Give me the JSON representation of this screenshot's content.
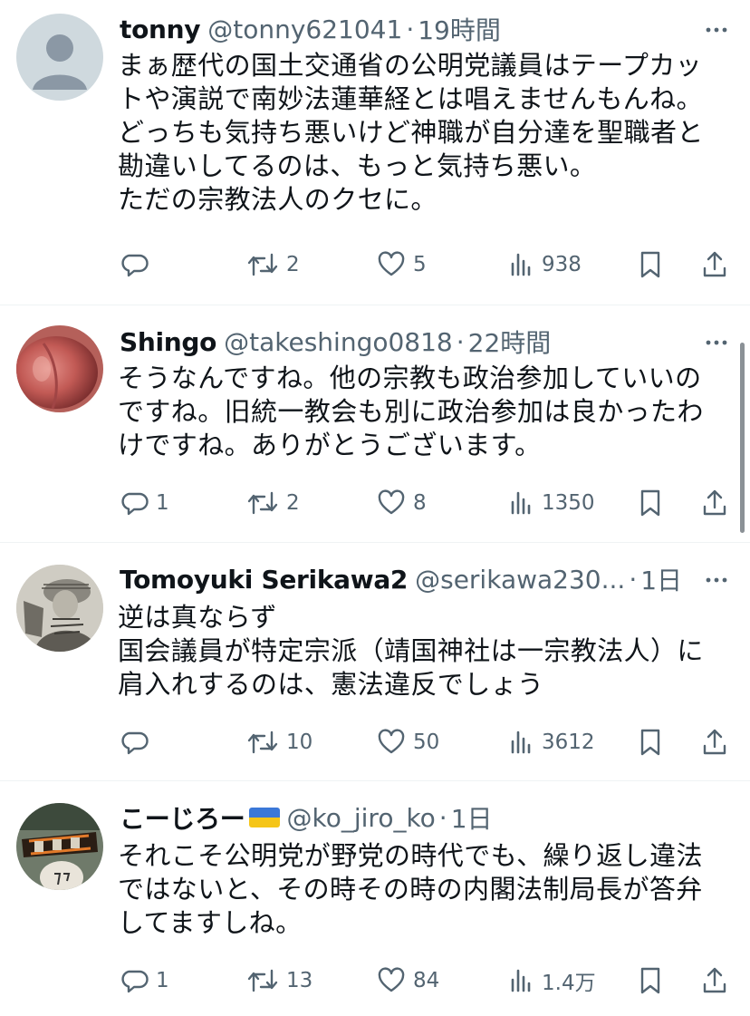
{
  "posts": [
    {
      "name": "tonny",
      "handle": "@tonny621041",
      "dot": "·",
      "time": "19時間",
      "text": "まぁ歴代の国土交通省の公明党議員はテープカットや演説で南妙法蓮華経とは唱えませんもんね。\nどっちも気持ち悪いけど神職が自分達を聖職者と勘違いしてるのは、もっと気持ち悪い。\nただの宗教法人のクセに。",
      "replies": "",
      "reposts": "2",
      "likes": "5",
      "views": "938"
    },
    {
      "name": "Shingo",
      "handle": "@takeshingo0818",
      "dot": "·",
      "time": "22時間",
      "text": "そうなんですね。他の宗教も政治参加していいのですね。旧統一教会も別に政治参加は良かったわけですね。ありがとうございます。",
      "replies": "1",
      "reposts": "2",
      "likes": "8",
      "views": "1350"
    },
    {
      "name": "Tomoyuki Serikawa2",
      "handle": "@serikawa230...",
      "dot": "·",
      "time": "1日",
      "text": "逆は真ならず\n国会議員が特定宗派（靖国神社は一宗教法人）に肩入れするのは、憲法違反でしょう",
      "replies": "",
      "reposts": "10",
      "likes": "50",
      "views": "3612"
    },
    {
      "name": "こーじろー",
      "handle": "@ko_jiro_ko",
      "dot": "·",
      "time": "1日",
      "text": "それこそ公明党が野党の時代でも、繰り返し違法ではないと、その時その時の内閣法制局長が答弁してますしね。",
      "replies": "1",
      "reposts": "13",
      "likes": "84",
      "views": "1.4万"
    }
  ],
  "icons": {
    "reply": "reply-icon",
    "repost": "repost-icon",
    "like": "heart-icon",
    "views": "views-icon",
    "bookmark": "bookmark-icon",
    "share": "share-icon",
    "more": "more-icon",
    "flag": "ukraine-flag-icon"
  },
  "colors": {
    "text": "#0f1419",
    "secondary": "#536471",
    "separator": "#eff3f4"
  }
}
